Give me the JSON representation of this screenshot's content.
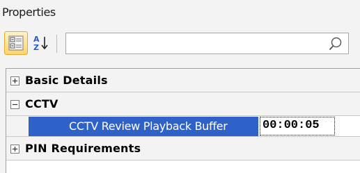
{
  "panel": {
    "title": "Properties"
  },
  "toolbar": {
    "categorized_icon": "categorized-view-icon",
    "alphabetical_icon": "sort-alphabetical-icon",
    "search": {
      "value": "",
      "placeholder": "",
      "icon": "search-icon"
    }
  },
  "grid": {
    "categories": [
      {
        "label": "Basic Details",
        "expanded": false,
        "expander": "⊞"
      },
      {
        "label": "CCTV",
        "expanded": true,
        "expander": "⊟"
      },
      {
        "label": "PIN Requirements",
        "expanded": false,
        "expander": "⊞"
      }
    ],
    "properties": [
      {
        "name": "CCTV Review Playback Buffer",
        "value": "00:00:05",
        "selected": true
      }
    ]
  },
  "colors": {
    "selection": "#2f62c9",
    "category_bg": "#f3f3f3",
    "active_button": "#ffd46a"
  }
}
